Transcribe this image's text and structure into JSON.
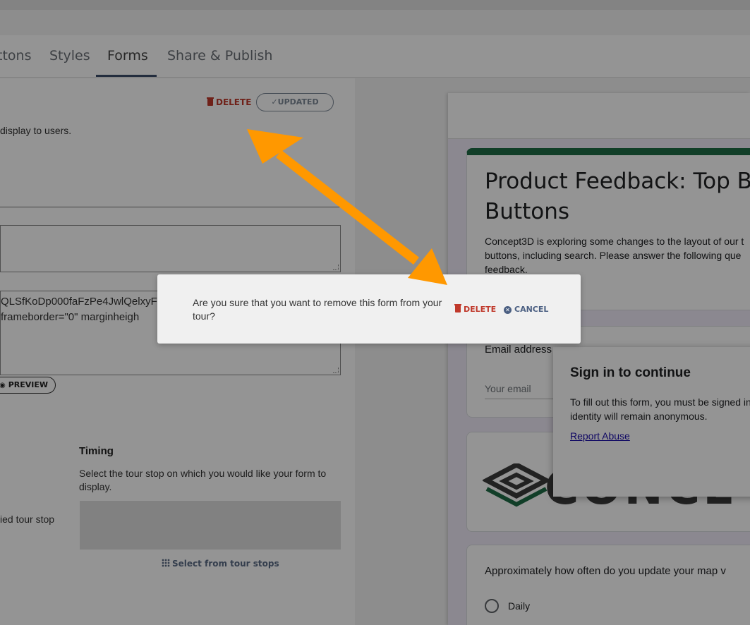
{
  "tabs": [
    {
      "label": "ttons"
    },
    {
      "label": "Styles"
    },
    {
      "label": "Forms",
      "active": true
    },
    {
      "label": "Share & Publish"
    }
  ],
  "form_panel": {
    "delete_label": "DELETE",
    "updated_label": "✓UPDATED",
    "description": "display to users.",
    "embed_code_line1": "QLSfKoDp000faFzPe4JwlQelxyF",
    "embed_code_line2": "frameborder=\"0\" marginheigh",
    "preview_label": "PREVIEW",
    "timing_title": "Timing",
    "timing_description": "Select the tour stop on which you would like your form to display.",
    "tied_label": "ied tour stop",
    "select_stops_label": "Select from tour stops"
  },
  "preview": {
    "form_title_line1": "Product Feedback: Top Ba",
    "form_title_line2": "Buttons",
    "form_desc_line1": "Concept3D is exploring some changes to the layout of our t",
    "form_desc_line2": "buttons, including search. Please answer the following que",
    "form_desc_line3": "feedback.",
    "email_label": "Email address",
    "email_placeholder": "Your email",
    "logo_text": "CONCE",
    "question": "Approximately how often do you update your map v",
    "option_daily": "Daily",
    "signin_title": "Sign in to continue",
    "signin_text_line1": "To fill out this form, you must be signed in",
    "signin_text_line2": "identity will remain anonymous.",
    "report_abuse": "Report Abuse"
  },
  "modal": {
    "message": "Are you sure that you want to remove this form from your tour?",
    "delete_label": "DELETE",
    "cancel_label": "CANCEL"
  },
  "colors": {
    "danger": "#c0392b",
    "accent": "#4b5f82",
    "arrow": "#ff9800",
    "form_header": "#1e6b46"
  }
}
